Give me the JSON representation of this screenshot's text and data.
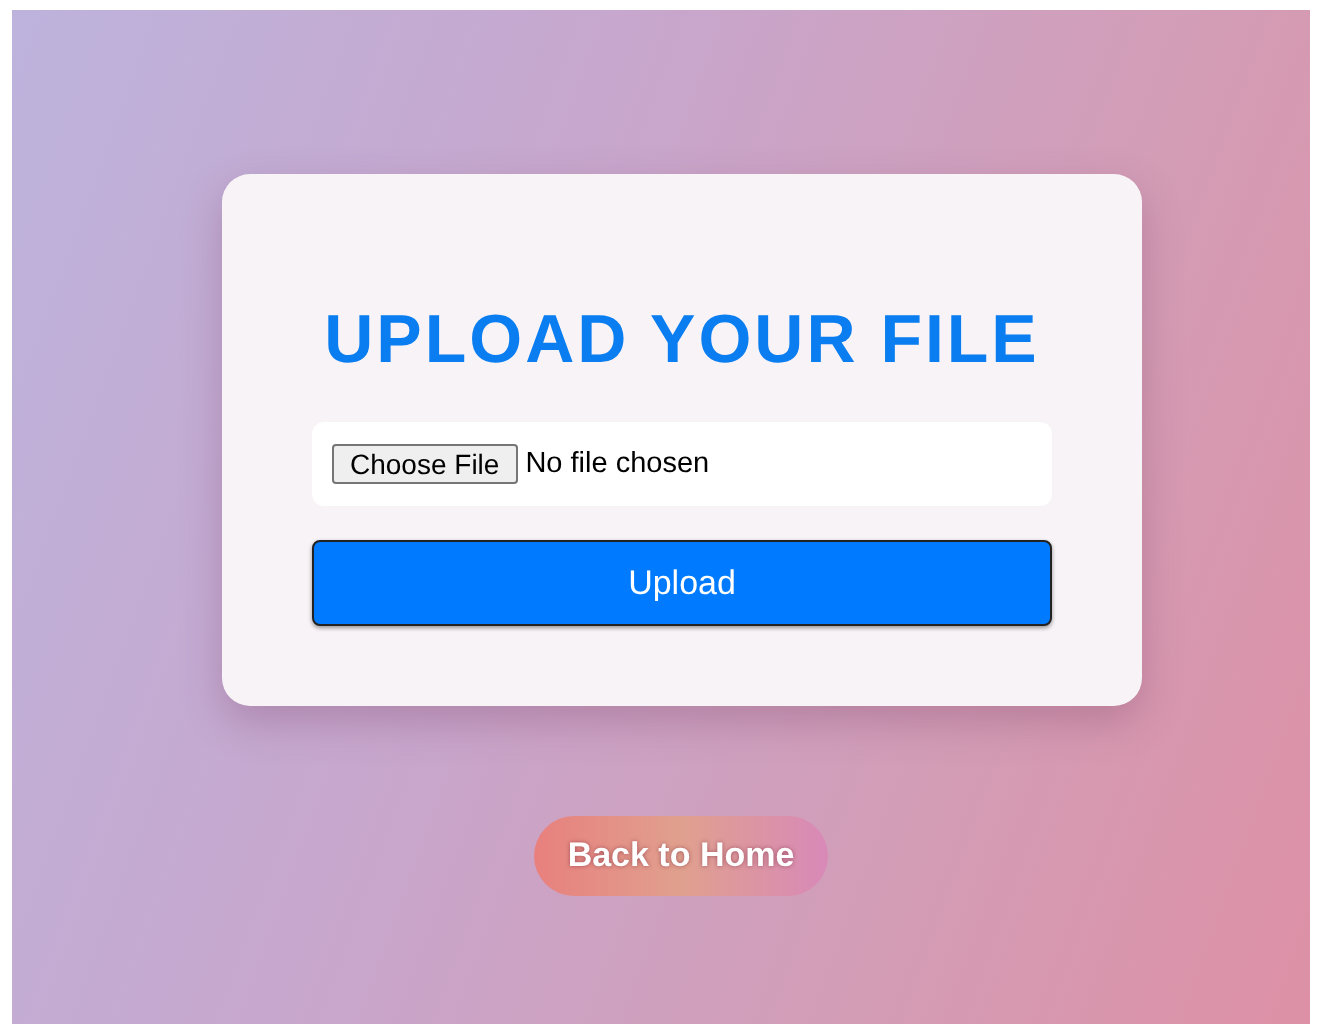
{
  "card": {
    "title": "UPLOAD YOUR FILE",
    "file_field": {
      "button": "Choose File",
      "value": "No file chosen"
    },
    "submit": "Upload"
  },
  "back_link": "Back to Home"
}
